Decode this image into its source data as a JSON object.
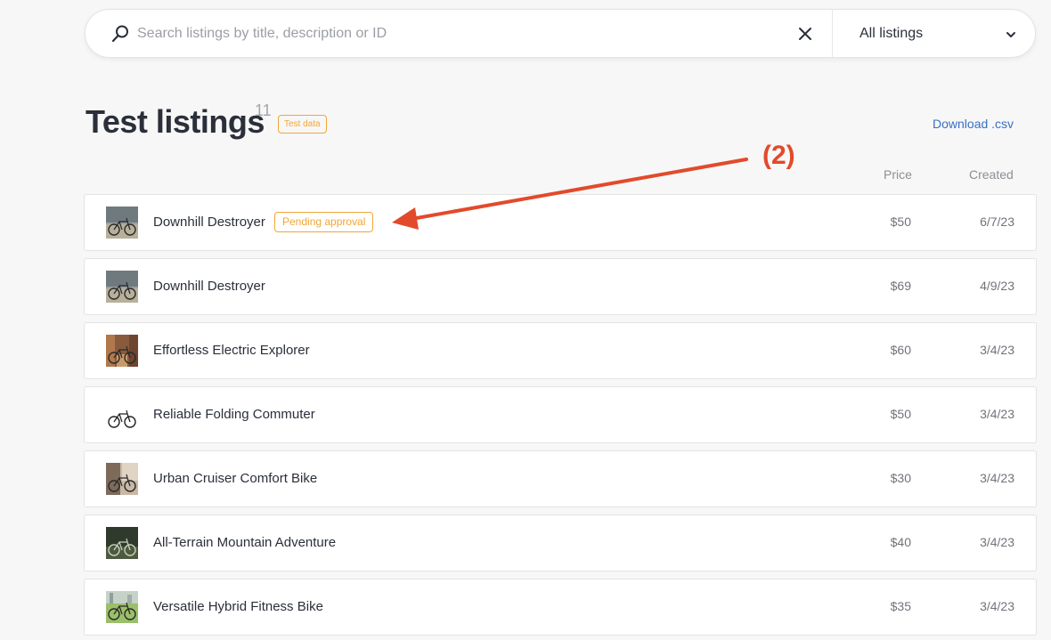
{
  "search": {
    "placeholder": "Search listings by title, description or ID",
    "value": "",
    "filter_selected": "All listings"
  },
  "header": {
    "title": "Test listings",
    "count": "11",
    "badge": "Test data",
    "download_label": "Download .csv",
    "col_price": "Price",
    "col_created": "Created"
  },
  "annotation": {
    "label": "(2)",
    "color": "#e24a2b"
  },
  "listings": [
    {
      "title": "Downhill Destroyer",
      "status": "Pending approval",
      "price": "$50",
      "created": "6/7/23",
      "thumb": "bike-on-street"
    },
    {
      "title": "Downhill Destroyer",
      "status": "",
      "price": "$69",
      "created": "4/9/23",
      "thumb": "bike-on-street"
    },
    {
      "title": "Effortless Electric Explorer",
      "status": "",
      "price": "$60",
      "created": "3/4/23",
      "thumb": "bike-in-alley"
    },
    {
      "title": "Reliable Folding Commuter",
      "status": "",
      "price": "$50",
      "created": "3/4/23",
      "thumb": "folding-bike"
    },
    {
      "title": "Urban Cruiser Comfort Bike",
      "status": "",
      "price": "$30",
      "created": "3/4/23",
      "thumb": "bike-by-wall"
    },
    {
      "title": "All-Terrain Mountain Adventure",
      "status": "",
      "price": "$40",
      "created": "3/4/23",
      "thumb": "mountain-bike"
    },
    {
      "title": "Versatile Hybrid Fitness Bike",
      "status": "",
      "price": "$35",
      "created": "3/4/23",
      "thumb": "hybrid-bike"
    }
  ]
}
